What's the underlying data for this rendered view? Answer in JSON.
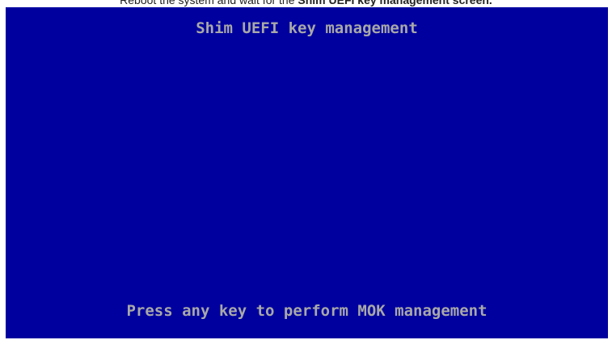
{
  "caption": {
    "prefix": "Reboot the system and wait for the ",
    "bold": "Shim UEFI key management screen."
  },
  "console": {
    "title": "Shim UEFI key management",
    "prompt": "Press any key to perform MOK management",
    "colors": {
      "background": "#00009f",
      "text": "#a8a8a8"
    }
  }
}
